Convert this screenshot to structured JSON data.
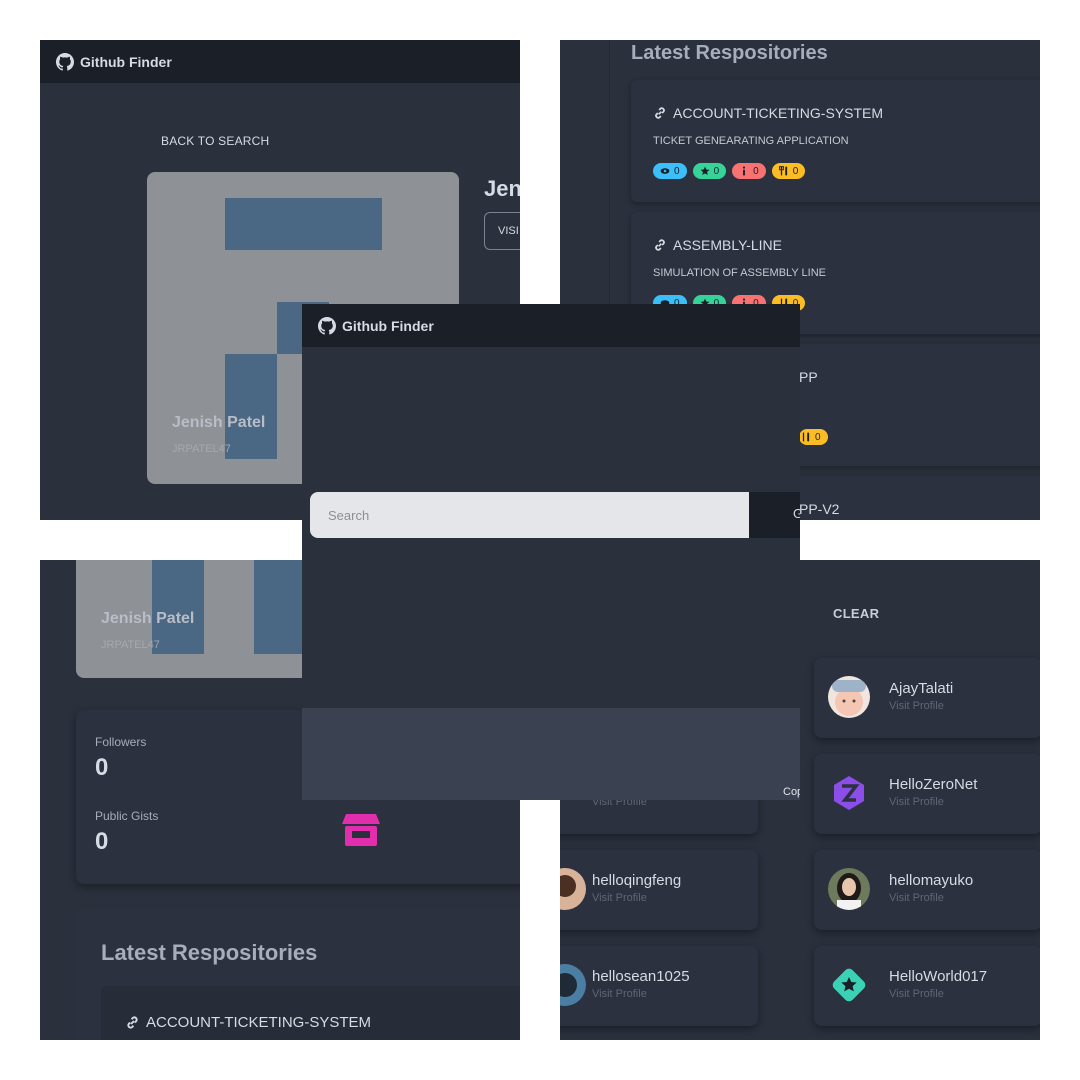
{
  "app": {
    "title": "Github Finder",
    "colors": {
      "navbar": "#1b1f27",
      "background": "#2a303c",
      "card": "#2b313e",
      "footer": "#3a4252",
      "accent_pink": "#e22dad"
    }
  },
  "profile": {
    "back_label": "BACK TO SEARCH",
    "name": "Jenish Patel",
    "login": "JRPATEL47",
    "name_partial": "Jen",
    "visit_partial": "VISI"
  },
  "repos": {
    "heading": "Latest Respositories",
    "items": [
      {
        "name": "ACCOUNT-TICKETING-SYSTEM",
        "description": "TICKET GENEARATING APPLICATION",
        "watchers": "0",
        "stars": "0",
        "issues": "0",
        "forks": "0"
      },
      {
        "name": "ASSEMBLY-LINE",
        "description": "SIMULATION OF ASSEMBLY LINE",
        "watchers": "0",
        "stars": "0",
        "issues": "0",
        "forks": "0"
      },
      {
        "name": "PP",
        "forks": "0"
      },
      {
        "name": "PP-V2"
      }
    ]
  },
  "stats": {
    "followers_label": "Followers",
    "followers_value": "0",
    "gists_label": "Public Gists",
    "gists_value": "0",
    "repos_heading": "Latest Respositories",
    "first_repo": "ACCOUNT-TICKETING-SYSTEM"
  },
  "users": {
    "clear_label": "CLEAR",
    "visit_label": "Visit Profile",
    "items": [
      {
        "login": "AjayTalati"
      },
      {
        "login": "HelloZeroNet"
      },
      {
        "login": "helloqingfeng"
      },
      {
        "login": "hellomayuko"
      },
      {
        "login": "hellosean1025"
      },
      {
        "login": "HelloWorld017"
      }
    ]
  },
  "search": {
    "placeholder": "Search",
    "go_partial": "G",
    "footer_partial": "Cop"
  }
}
